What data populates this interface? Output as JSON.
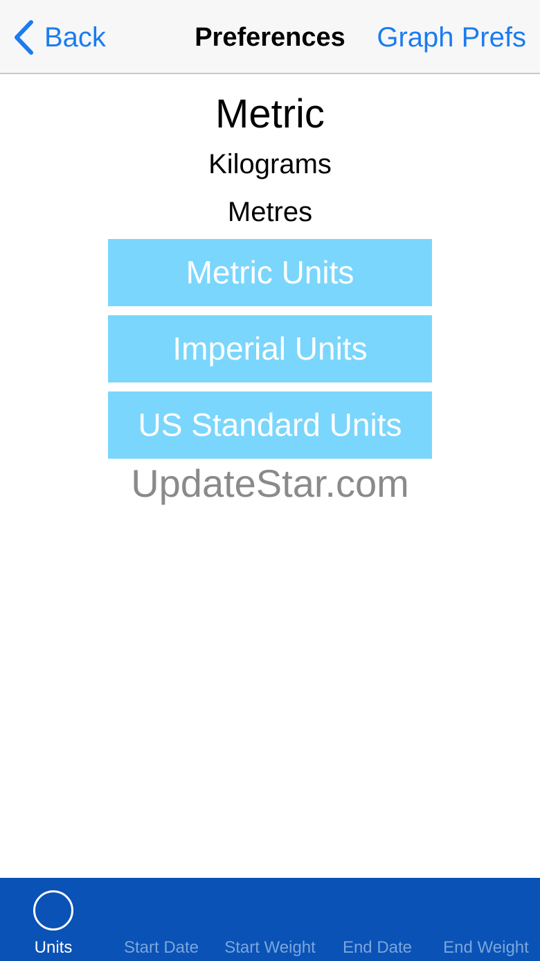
{
  "nav": {
    "back_label": "Back",
    "title": "Preferences",
    "right_label": "Graph Prefs",
    "accent_color": "#1a7cf0"
  },
  "current": {
    "system": "Metric",
    "weight_unit": "Kilograms",
    "length_unit": "Metres"
  },
  "buttons": {
    "metric": "Metric Units",
    "imperial": "Imperial Units",
    "us_standard": "US Standard Units",
    "color": "#7ad6fc"
  },
  "watermark": "UpdateStar.com",
  "tabbar": {
    "background": "#0a52b5",
    "tabs": [
      {
        "label": "Units",
        "icon": "circle-icon",
        "active": true
      },
      {
        "label": "Start Date",
        "active": false
      },
      {
        "label": "Start Weight",
        "active": false
      },
      {
        "label": "End Date",
        "active": false
      },
      {
        "label": "End Weight",
        "active": false
      }
    ]
  }
}
